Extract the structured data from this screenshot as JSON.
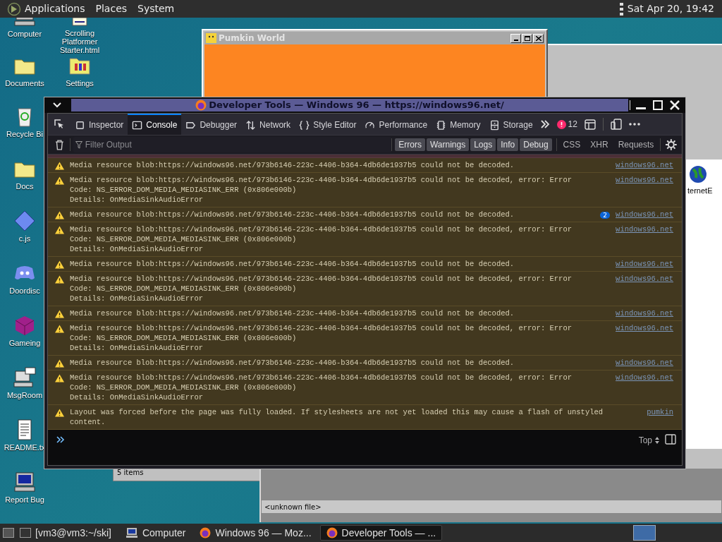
{
  "top_bar": {
    "menus": [
      "Applications",
      "Places",
      "System"
    ],
    "clock": "Sat Apr 20, 19:42"
  },
  "desktop_icons": [
    {
      "label": "Computer",
      "kind": "computer"
    },
    {
      "label": "Scrolling Platformer Starter.html",
      "kind": "page"
    },
    {
      "label": "Documents",
      "kind": "folder"
    },
    {
      "label": "Settings",
      "kind": "settings"
    },
    {
      "label": "Recycle Bi",
      "kind": "bin"
    },
    {
      "label": "Docs",
      "kind": "folder"
    },
    {
      "label": "c.js",
      "kind": "diamond"
    },
    {
      "label": "Doordisc",
      "kind": "chat"
    },
    {
      "label": "Gameing",
      "kind": "cube"
    },
    {
      "label": "MsgRoom",
      "kind": "msg"
    },
    {
      "label": "README.tx",
      "kind": "text"
    },
    {
      "label": "Report Bug",
      "kind": "computer"
    }
  ],
  "internet_icon": {
    "label": "ternetE"
  },
  "game_window": {
    "title": "Pumkin World"
  },
  "file_window": {
    "status": "5 items"
  },
  "viewer_window": {
    "status": "<unknown file>"
  },
  "devtools": {
    "title": "Developer Tools — Windows 96 — https://windows96.net/",
    "tabs": [
      {
        "label": "Inspector",
        "kind": "box",
        "selected": false
      },
      {
        "label": "Console",
        "kind": "console",
        "selected": true
      },
      {
        "label": "Debugger",
        "kind": "tag",
        "selected": false
      },
      {
        "label": "Network",
        "kind": "arrows",
        "selected": false
      },
      {
        "label": "Style Editor",
        "kind": "braces",
        "selected": false
      },
      {
        "label": "Performance",
        "kind": "gauge",
        "selected": false
      },
      {
        "label": "Memory",
        "kind": "chip",
        "selected": false
      },
      {
        "label": "Storage",
        "kind": "storage",
        "selected": false
      }
    ],
    "error_count": "12",
    "filter_placeholder": "Filter Output",
    "filters": [
      {
        "label": "Errors",
        "selected": true
      },
      {
        "label": "Warnings",
        "selected": true
      },
      {
        "label": "Logs",
        "selected": true
      },
      {
        "label": "Info",
        "selected": true
      },
      {
        "label": "Debug",
        "selected": true
      }
    ],
    "extra_filters": [
      {
        "label": "CSS",
        "selected": false
      },
      {
        "label": "XHR",
        "selected": false
      },
      {
        "label": "Requests",
        "selected": false
      }
    ],
    "messages": [
      {
        "kind": "warning",
        "lines": [
          "Media resource blob:https://windows96.net/973b6146-223c-4406-b364-4db6de1937b5 could not be decoded."
        ],
        "source": "windows96.net"
      },
      {
        "kind": "warning",
        "lines": [
          "Media resource blob:https://windows96.net/973b6146-223c-4406-b364-4db6de1937b5 could not be decoded, error: Error",
          "Code: NS_ERROR_DOM_MEDIA_MEDIASINK_ERR (0x806e000b)",
          "Details: OnMediaSinkAudioError"
        ],
        "source": "windows96.net"
      },
      {
        "kind": "warning",
        "lines": [
          "Media resource blob:https://windows96.net/973b6146-223c-4406-b364-4db6de1937b5 could not be decoded."
        ],
        "repeat": "2",
        "source": "windows96.net"
      },
      {
        "kind": "warning",
        "lines": [
          "Media resource blob:https://windows96.net/973b6146-223c-4406-b364-4db6de1937b5 could not be decoded, error: Error",
          "Code: NS_ERROR_DOM_MEDIA_MEDIASINK_ERR (0x806e000b)",
          "Details: OnMediaSinkAudioError"
        ],
        "source": "windows96.net"
      },
      {
        "kind": "warning",
        "lines": [
          "Media resource blob:https://windows96.net/973b6146-223c-4406-b364-4db6de1937b5 could not be decoded."
        ],
        "source": "windows96.net"
      },
      {
        "kind": "warning",
        "lines": [
          "Media resource blob:https://windows96.net/973b6146-223c-4406-b364-4db6de1937b5 could not be decoded, error: Error",
          "Code: NS_ERROR_DOM_MEDIA_MEDIASINK_ERR (0x806e000b)",
          "Details: OnMediaSinkAudioError"
        ],
        "source": "windows96.net"
      },
      {
        "kind": "warning",
        "lines": [
          "Media resource blob:https://windows96.net/973b6146-223c-4406-b364-4db6de1937b5 could not be decoded."
        ],
        "source": "windows96.net"
      },
      {
        "kind": "warning",
        "lines": [
          "Media resource blob:https://windows96.net/973b6146-223c-4406-b364-4db6de1937b5 could not be decoded, error: Error",
          "Code: NS_ERROR_DOM_MEDIA_MEDIASINK_ERR (0x806e000b)",
          "Details: OnMediaSinkAudioError"
        ],
        "source": "windows96.net"
      },
      {
        "kind": "warning",
        "lines": [
          "Media resource blob:https://windows96.net/973b6146-223c-4406-b364-4db6de1937b5 could not be decoded."
        ],
        "source": "windows96.net"
      },
      {
        "kind": "warning",
        "lines": [
          "Media resource blob:https://windows96.net/973b6146-223c-4406-b364-4db6de1937b5 could not be decoded, error: Error",
          "Code: NS_ERROR_DOM_MEDIA_MEDIASINK_ERR (0x806e000b)",
          "Details: OnMediaSinkAudioError"
        ],
        "source": "windows96.net"
      },
      {
        "kind": "warning",
        "lines": [
          "Layout was forced before the page was fully loaded. If stylesheets are not yet loaded this may cause a flash of unstyled content."
        ],
        "source": "pumkin"
      }
    ],
    "context": "Top"
  },
  "taskbar": {
    "items": [
      {
        "label": "[vm3@vm3:~/ski]",
        "kind": "terminal",
        "selected": false
      },
      {
        "label": "Computer",
        "kind": "computer",
        "selected": false
      },
      {
        "label": "Windows 96 — Moz...",
        "kind": "firefox",
        "selected": false
      },
      {
        "label": "Developer Tools — ...",
        "kind": "firefox",
        "selected": true
      }
    ]
  }
}
